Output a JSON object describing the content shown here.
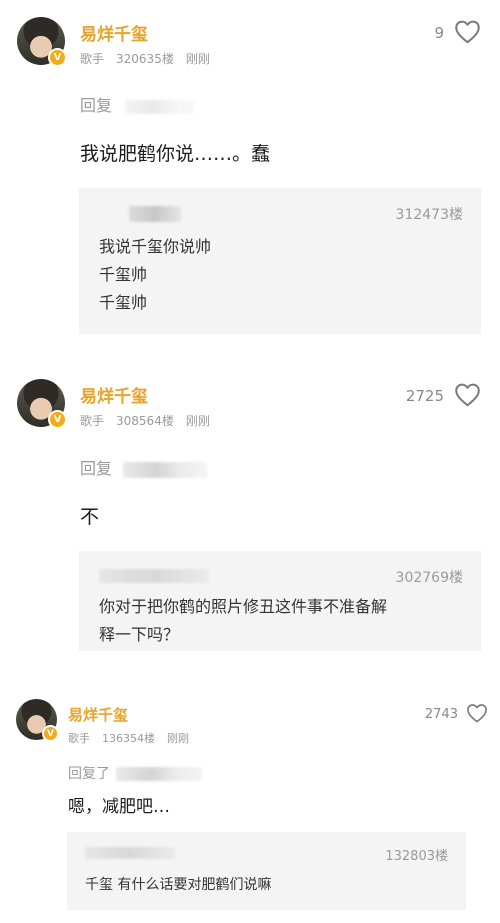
{
  "comments": [
    {
      "username": "易烊千玺",
      "role": "歌手",
      "floor": "320635楼",
      "time": "刚刚",
      "likes": "9",
      "reply_prefix": "回复",
      "content": "我说肥鹤你说……。蠢",
      "quote": {
        "floor": "312473楼",
        "lines": [
          "我说千玺你说帅",
          "千玺帅",
          "千玺帅"
        ]
      }
    },
    {
      "username": "易烊千玺",
      "role": "歌手",
      "floor": "308564楼",
      "time": "刚刚",
      "likes": "2725",
      "reply_prefix": "回复",
      "content": "不",
      "quote": {
        "floor": "302769楼",
        "lines": [
          "你对于把你鹤的照片修丑这件事不准备解",
          "释一下吗？"
        ]
      }
    },
    {
      "username": "易烊千玺",
      "role": "歌手",
      "floor": "136354楼",
      "time": "刚刚",
      "likes": "2743",
      "reply_prefix": "回复了",
      "content": "嗯，减肥吧…",
      "quote": {
        "floor": "132803楼",
        "lines": [
          "千玺 有什么话要对肥鹤们说嘛"
        ]
      }
    }
  ],
  "icons": {
    "heart": "heart-outline-icon",
    "verified": "verified-badge-icon"
  },
  "colors": {
    "username": "#e8a32b",
    "meta": "#9a9a9a",
    "quote_bg": "#f4f4f4",
    "badge": "#f4ab1a"
  },
  "verified_mark": "V"
}
